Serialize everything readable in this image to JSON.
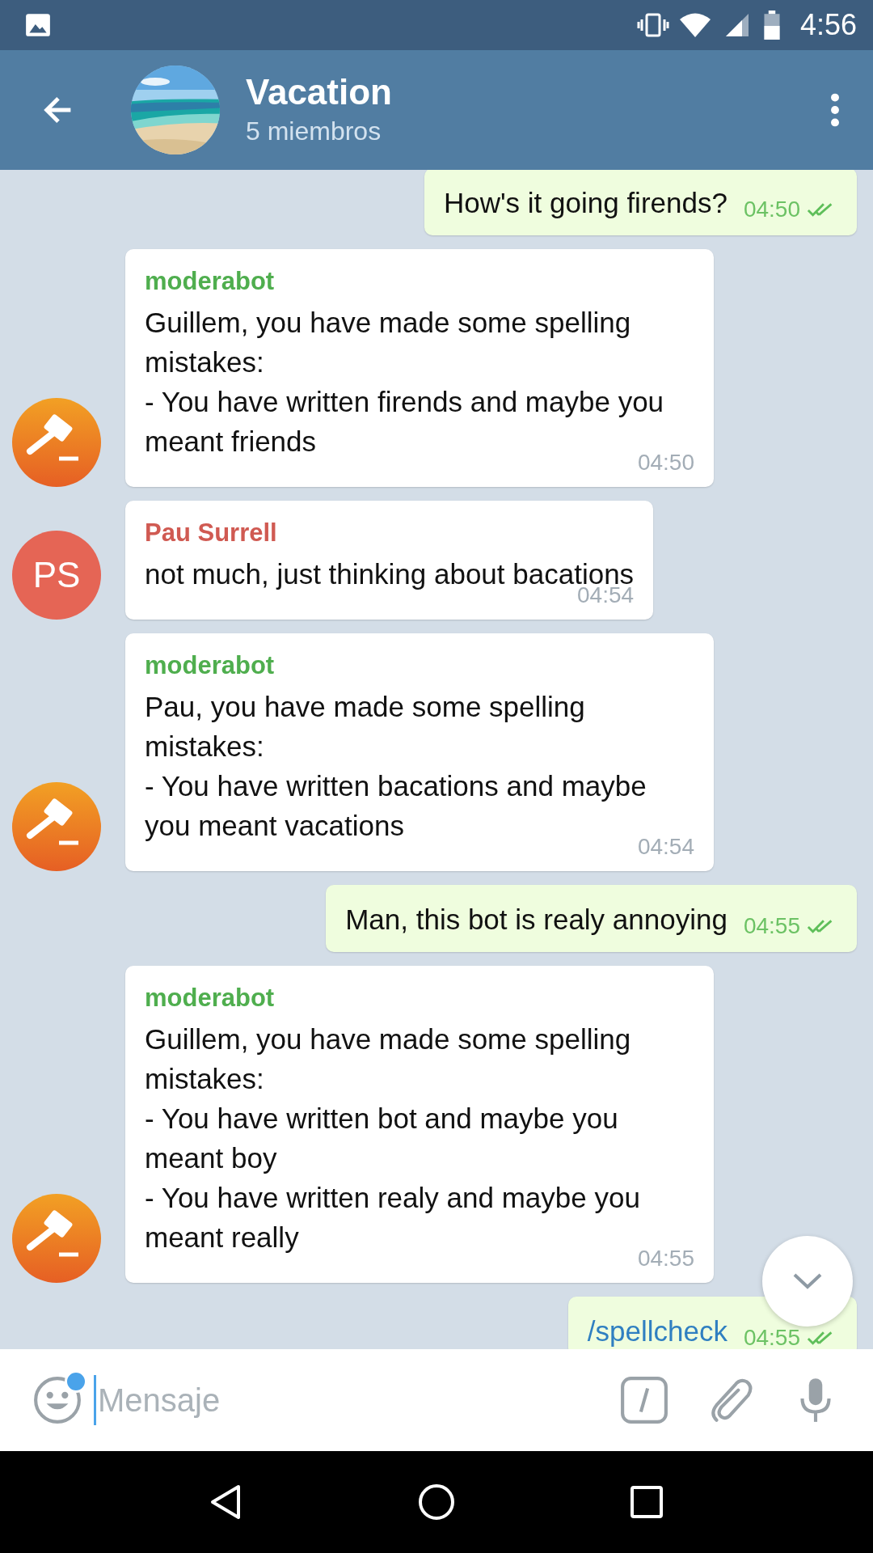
{
  "status_bar": {
    "time": "4:56"
  },
  "header": {
    "title": "Vacation",
    "subtitle": "5 miembros"
  },
  "messages": [
    {
      "kind": "outgoing",
      "text": "How's it going firends?",
      "time": "04:50",
      "read": true
    },
    {
      "kind": "incoming",
      "sender": "moderabot",
      "color": "#4fae4e",
      "avatar": {
        "kind": "bot"
      },
      "text": "Guillem, you have made some spelling mistakes:\n- You have written firends and maybe you meant friends",
      "time": "04:50"
    },
    {
      "kind": "incoming",
      "sender": "Pau Surrell",
      "color": "#d05a52",
      "avatar": {
        "kind": "initials",
        "initials": "PS",
        "color": "#e56555"
      },
      "text": "not much, just thinking about bacations",
      "time": "04:54"
    },
    {
      "kind": "incoming",
      "sender": "moderabot",
      "color": "#4fae4e",
      "avatar": {
        "kind": "bot"
      },
      "text": "Pau, you have made some spelling mistakes:\n- You have written bacations and maybe you meant vacations",
      "time": "04:54"
    },
    {
      "kind": "outgoing",
      "text": "Man, this bot is realy annoying",
      "time": "04:55",
      "read": true
    },
    {
      "kind": "incoming",
      "sender": "moderabot",
      "color": "#4fae4e",
      "avatar": {
        "kind": "bot"
      },
      "text": "Guillem, you have made some spelling mistakes:\n- You have written bot and maybe you meant boy\n- You have written realy and maybe you meant really",
      "time": "04:55"
    },
    {
      "kind": "command",
      "text": "/spellcheck",
      "time": "04:55",
      "read": true
    }
  ],
  "composer": {
    "placeholder": "Mensaje",
    "emoji_badge": true
  }
}
